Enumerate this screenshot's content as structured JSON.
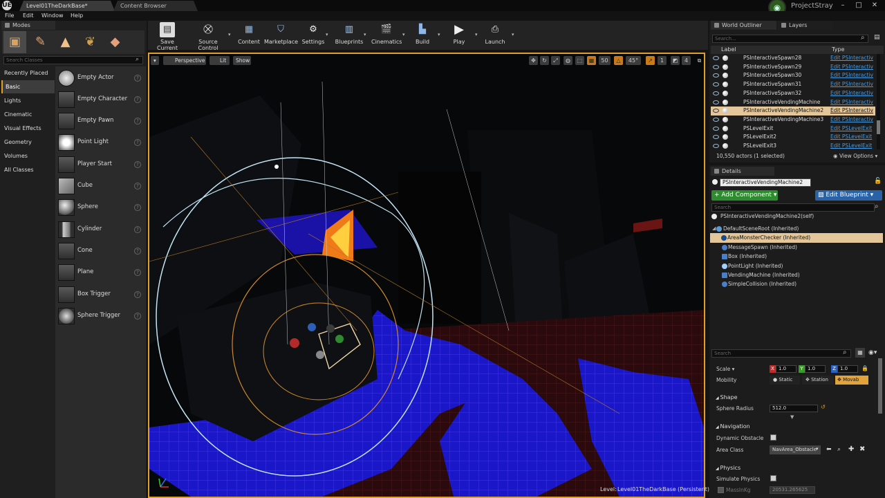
{
  "title_bar": {
    "tabs": [
      "Level01TheDarkBase*",
      "Content Browser"
    ],
    "project": "ProjectStray",
    "logo": "UE"
  },
  "menu": [
    "File",
    "Edit",
    "Window",
    "Help"
  ],
  "modes": {
    "tab": "Modes",
    "search_placeholder": "Search Classes",
    "categories": [
      "Recently Placed",
      "Basic",
      "Lights",
      "Cinematic",
      "Visual Effects",
      "Geometry",
      "Volumes",
      "All Classes"
    ],
    "items": [
      "Empty Actor",
      "Empty Character",
      "Empty Pawn",
      "Point Light",
      "Player Start",
      "Cube",
      "Sphere",
      "Cylinder",
      "Cone",
      "Plane",
      "Box Trigger",
      "Sphere Trigger"
    ]
  },
  "toolbar": {
    "buttons": [
      "Save Current",
      "Source Control",
      "Content",
      "Marketplace",
      "Settings",
      "Blueprints",
      "Cinematics",
      "Build",
      "Play",
      "Launch"
    ]
  },
  "viewport": {
    "perspective": "Perspective",
    "lit": "Lit",
    "show": "Show",
    "grid_snap": "50",
    "rot_snap": "45°",
    "scale_snap": "1",
    "cam_speed": "4",
    "level_label": "Level:",
    "level_name": "Level01TheDarkBase (Persistent)"
  },
  "outliner": {
    "tabs": [
      "World Outliner",
      "Layers"
    ],
    "search_placeholder": "Search...",
    "col_label": "Label",
    "col_type": "Type",
    "rows": [
      {
        "label": "PSInteractiveSpawn28",
        "type": "Edit PSInteractiv"
      },
      {
        "label": "PSInteractiveSpawn29",
        "type": "Edit PSInteractiv"
      },
      {
        "label": "PSInteractiveSpawn30",
        "type": "Edit PSInteractiv"
      },
      {
        "label": "PSInteractiveSpawn31",
        "type": "Edit PSInteractiv"
      },
      {
        "label": "PSInteractiveSpawn32",
        "type": "Edit PSInteractiv"
      },
      {
        "label": "PSInteractiveVendingMachine",
        "type": "Edit PSInteractiv"
      },
      {
        "label": "PSInteractiveVendingMachine2",
        "type": "Edit PSInteractiv"
      },
      {
        "label": "PSInteractiveVendingMachine3",
        "type": "Edit PSInteractiv"
      },
      {
        "label": "PSLevelExit",
        "type": "Edit PSLevelExit"
      },
      {
        "label": "PSLevelExit2",
        "type": "Edit PSLevelExit"
      },
      {
        "label": "PSLevelExit3",
        "type": "Edit PSLevelExit"
      }
    ],
    "count": "10,550 actors (1 selected)",
    "view_options": "View Options"
  },
  "details": {
    "tab": "Details",
    "name": "PSInteractiveVendingMachine2",
    "add_component": "+ Add Component",
    "edit_blueprint": "Edit Blueprint",
    "search_placeholder": "Search",
    "self": "PSInteractiveVendingMachine2(self)",
    "components": [
      "DefaultSceneRoot (Inherited)",
      "AreaMonsterChecker (Inherited)",
      "MessageSpawn (Inherited)",
      "Box (Inherited)",
      "PointLight (Inherited)",
      "VendingMachine (Inherited)",
      "SimpleCollision (Inherited)"
    ],
    "search2": "Search",
    "scale_label": "Scale",
    "scale": [
      "1.0",
      "1.0",
      "1.0"
    ],
    "axes": [
      "X",
      "Y",
      "Z"
    ],
    "mobility_label": "Mobility",
    "mobility": [
      "Static",
      "Station",
      "Movab"
    ],
    "shape_head": "Shape",
    "sphere_radius_label": "Sphere Radius",
    "sphere_radius": "512.0",
    "nav_head": "Navigation",
    "dynamic_obstacle": "Dynamic Obstacle",
    "area_class_label": "Area Class",
    "area_class": "NavArea_Obstacle",
    "physics_head": "Physics",
    "simulate_physics": "Simulate Physics",
    "mass_label": "MassInKg",
    "mass": "20531.265625"
  }
}
